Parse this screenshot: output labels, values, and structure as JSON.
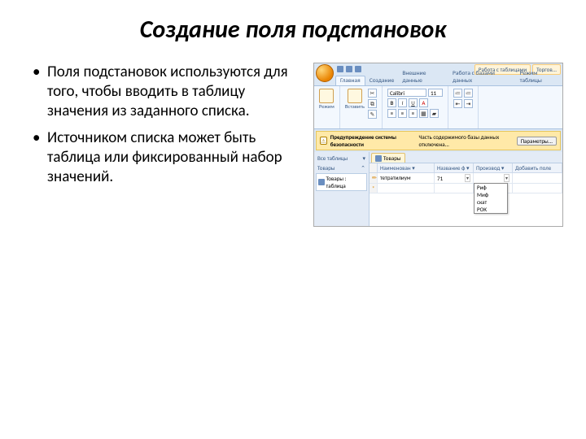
{
  "title": "Создание поля подстановок",
  "bullets": [
    "Поля подстановок используются для того, чтобы вводить в таблицу значения из заданного списка.",
    "Источником списка может быть таблица или фиксированный набор значений."
  ],
  "screenshot": {
    "contextual_tabs": [
      "Работа с таблицами",
      "Торгов..."
    ],
    "ribbon_tabs": [
      "Главная",
      "Создание",
      "Внешние данные",
      "Работа с базами данных",
      "Режим таблицы"
    ],
    "active_tab_index": 0,
    "ribbon_groups": {
      "view_btn": "Режим",
      "paste_btn": "Вставить",
      "font_name": "Calibri",
      "font_size": "11"
    },
    "warn_bar": {
      "label": "Предупреждение системы безопасности",
      "text": "Часть содержимого базы данных отключена...",
      "button": "Параметры..."
    },
    "nav": {
      "header": "Все таблицы",
      "group": "Товары",
      "item": "Товары : таблица"
    },
    "doc_tab": "Товары",
    "columns": [
      "",
      "Наименован",
      "Название ф",
      "Производ",
      "Добавить поле"
    ],
    "first_row": {
      "name": "тетратилиум",
      "val": "71"
    },
    "dropdown_items": [
      "Риф",
      "Миф",
      "скат",
      "РОК"
    ]
  }
}
